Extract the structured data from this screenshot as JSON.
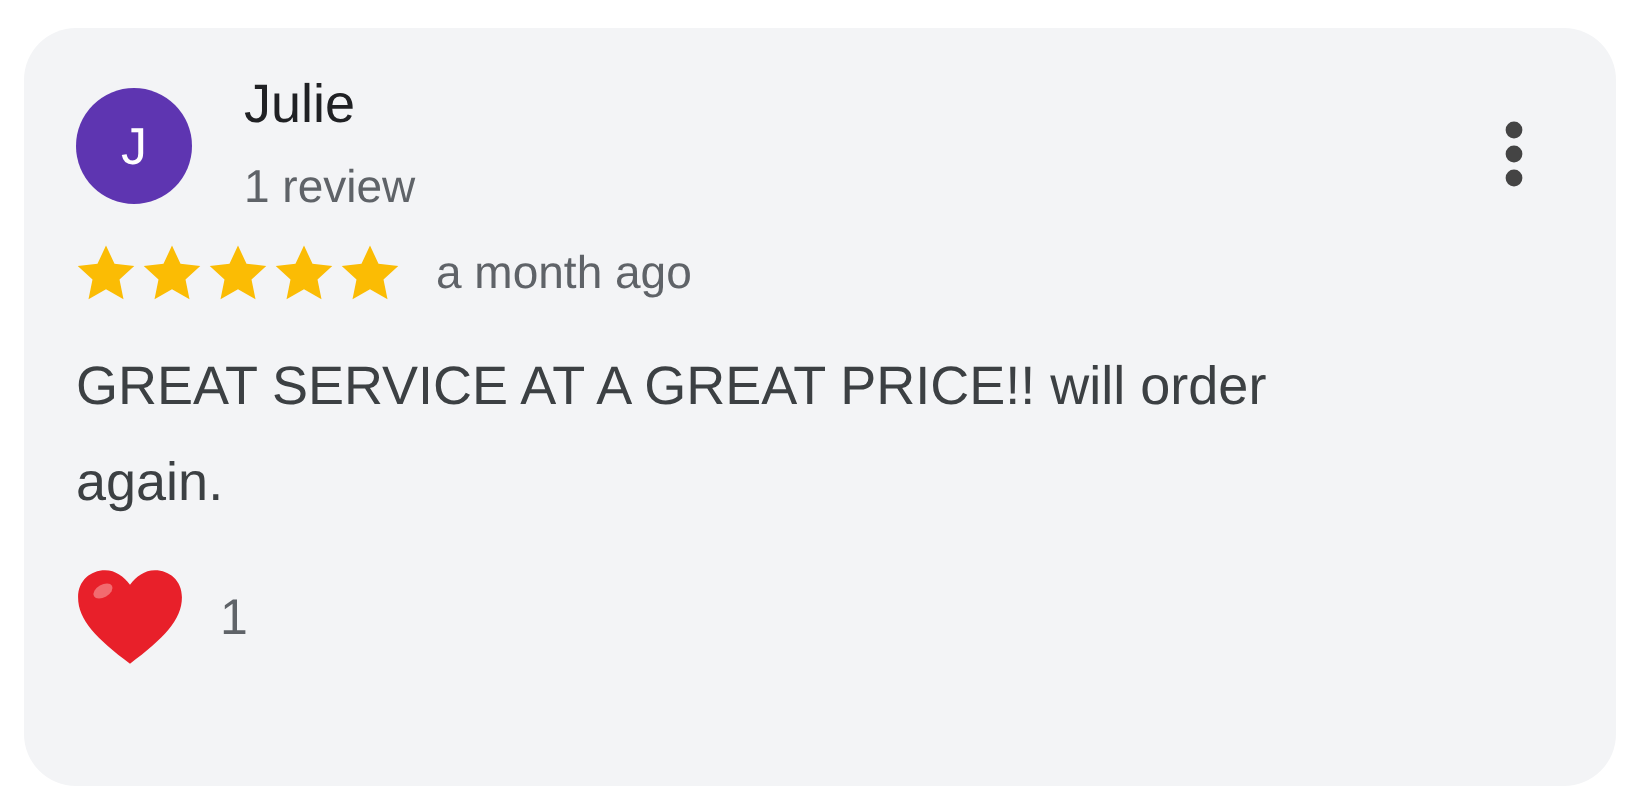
{
  "review": {
    "avatar_letter": "J",
    "reviewer": "Julie",
    "review_count": "1 review",
    "stars": 5,
    "time": "a month ago",
    "text": "GREAT SERVICE AT A GREAT PRICE!! will order again.",
    "likes": "1"
  }
}
